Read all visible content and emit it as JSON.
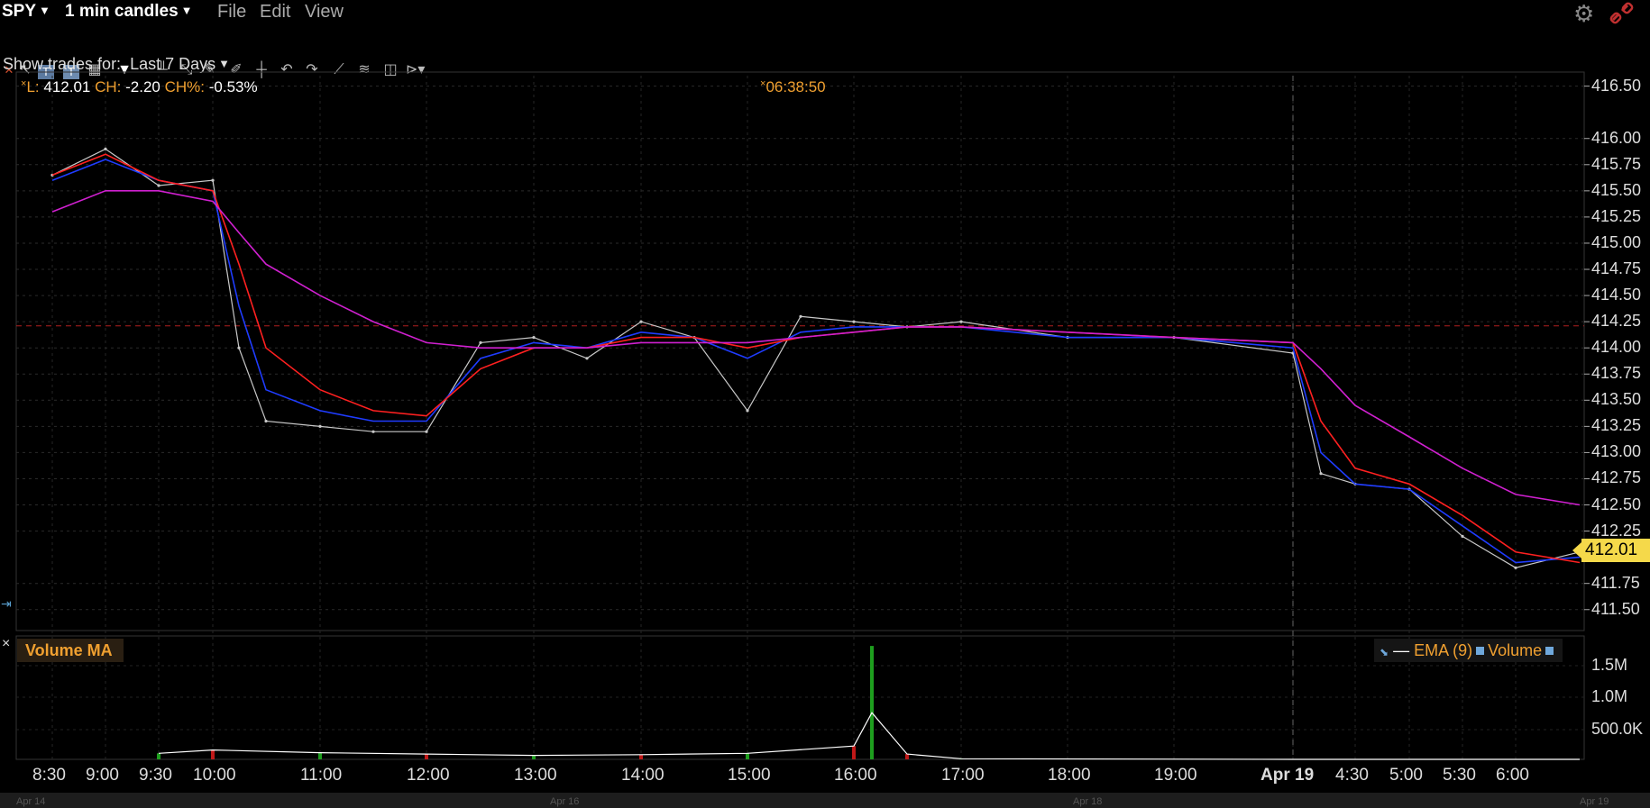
{
  "menubar": {
    "symbol": "SPY",
    "period": "1 min candles",
    "items": [
      "File",
      "Edit",
      "View"
    ]
  },
  "toolbar": {
    "icons": [
      "close-icon",
      "pointer-icon",
      "text-icon",
      "text-box-icon",
      "grid-icon",
      "filter-icon",
      "bar-type-icon",
      "draw-icon",
      "pencil-icon",
      "brush-icon",
      "crosshair-icon",
      "undo-icon",
      "redo-icon",
      "trendline-icon",
      "fibonacci-icon",
      "pan-icon",
      "more-icon"
    ]
  },
  "show_trades": {
    "label": "Show trades for:",
    "value": "Last 7 Days"
  },
  "info": {
    "last_label": "L:",
    "last": "412.01",
    "ch_label": "CH:",
    "ch": "-2.20",
    "chp_label": "CH%:",
    "chp": "-0.53%",
    "time": "06:38:50"
  },
  "price_badge": "412.01",
  "volume_panel": {
    "title": "Volume MA",
    "legend_ema": "EMA (9)",
    "legend_volume": "Volume"
  },
  "colors": {
    "price": "#c8c8c8",
    "ema_fast": "#1f3cff",
    "ema_mid": "#ff2020",
    "ema_slow": "#d020d0",
    "reference_line": "#b02020",
    "vol_up": "#1e9e1e",
    "vol_down": "#c01818",
    "badge": "#f5d94a"
  },
  "chart_data": {
    "type": "line",
    "price_axis_ticks": [
      "416.50",
      "416.00",
      "415.75",
      "415.50",
      "415.25",
      "415.00",
      "414.75",
      "414.50",
      "414.25",
      "414.00",
      "413.75",
      "413.50",
      "413.25",
      "413.00",
      "412.75",
      "412.50",
      "412.25",
      "411.75",
      "411.50"
    ],
    "volume_axis_ticks": [
      "1.5M",
      "1.0M",
      "500.0K"
    ],
    "time_ticks": [
      "8:30",
      "9:00",
      "9:30",
      "10:00",
      "11:00",
      "12:00",
      "13:00",
      "14:00",
      "15:00",
      "16:00",
      "17:00",
      "18:00",
      "19:00",
      "Apr 19",
      "4:30",
      "5:00",
      "5:30",
      "6:00"
    ],
    "date_ticks": [
      "Apr 14",
      "Apr 16",
      "Apr 18",
      "Apr 19"
    ],
    "ylim": [
      411.3,
      416.6
    ],
    "reference_price": 414.21,
    "session_break": "Apr 19",
    "x": [
      "8:30",
      "9:00",
      "9:30",
      "10:00",
      "10:15",
      "10:30",
      "11:00",
      "11:30",
      "12:00",
      "12:30",
      "13:00",
      "13:30",
      "14:00",
      "14:30",
      "15:00",
      "15:30",
      "16:00",
      "16:30",
      "17:00",
      "18:00",
      "19:00",
      "Apr 19",
      "4:15",
      "4:30",
      "5:00",
      "5:30",
      "6:00",
      "6:30"
    ],
    "series": [
      {
        "name": "",
        "values": [
          415.65,
          415.9,
          415.55,
          415.6,
          414.0,
          413.3,
          413.25,
          413.2,
          413.2,
          414.05,
          414.1,
          413.9,
          414.25,
          414.1,
          413.4,
          414.3,
          414.25,
          414.2,
          414.25,
          414.1,
          414.1,
          413.95,
          412.8,
          412.7,
          412.65,
          412.2,
          411.9,
          412.05
        ]
      },
      {
        "name": "",
        "values": [
          415.6,
          415.8,
          415.6,
          415.5,
          414.4,
          413.6,
          413.4,
          413.3,
          413.3,
          413.9,
          414.05,
          414.0,
          414.15,
          414.1,
          413.9,
          414.15,
          414.2,
          414.2,
          414.2,
          414.1,
          414.1,
          414.0,
          413.0,
          412.7,
          412.65,
          412.3,
          411.95,
          412.0
        ]
      },
      {
        "name": "",
        "values": [
          415.65,
          415.85,
          415.6,
          415.5,
          414.8,
          414.0,
          413.6,
          413.4,
          413.35,
          413.8,
          414.0,
          414.0,
          414.1,
          414.1,
          414.0,
          414.1,
          414.15,
          414.2,
          414.2,
          414.15,
          414.1,
          414.05,
          413.3,
          412.85,
          412.7,
          412.4,
          412.05,
          411.95
        ]
      },
      {
        "name": "",
        "values": [
          415.3,
          415.5,
          415.5,
          415.4,
          415.1,
          414.8,
          414.5,
          414.25,
          414.05,
          414.0,
          414.0,
          414.0,
          414.05,
          414.05,
          414.05,
          414.1,
          414.15,
          414.2,
          414.2,
          414.15,
          414.1,
          414.05,
          413.8,
          413.45,
          413.15,
          412.85,
          412.6,
          412.5
        ]
      }
    ],
    "volume": {
      "x": [
        "9:30",
        "10:00",
        "11:00",
        "12:00",
        "13:00",
        "14:00",
        "15:00",
        "16:00",
        "16:10",
        "16:30",
        "17:00",
        "Apr 19",
        "6:30"
      ],
      "values": [
        90000,
        140000,
        100000,
        80000,
        60000,
        70000,
        90000,
        200000,
        1700000,
        80000,
        10000,
        0,
        0
      ]
    }
  }
}
